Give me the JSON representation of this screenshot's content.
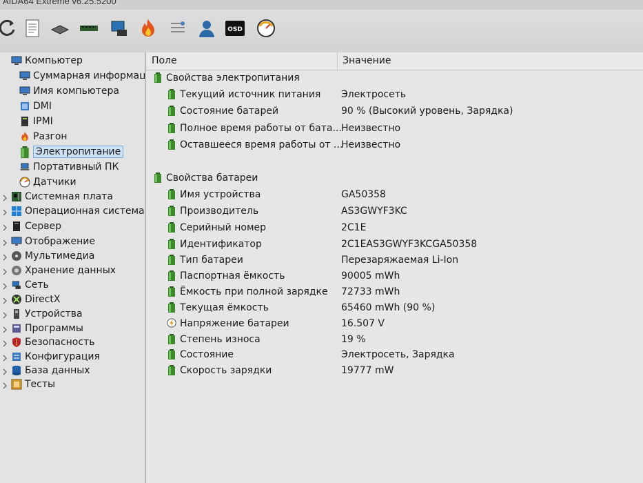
{
  "window": {
    "title": "AIDA64 Extreme v6.25.5200"
  },
  "toolbar": {
    "buttons": [
      {
        "name": "refresh-icon"
      },
      {
        "name": "report-icon"
      },
      {
        "name": "cpu-chip-icon"
      },
      {
        "name": "memory-icon"
      },
      {
        "name": "network-icon"
      },
      {
        "name": "flame-icon"
      },
      {
        "name": "checklist-icon"
      },
      {
        "name": "user-icon"
      },
      {
        "name": "osd-icon",
        "label": "OSD"
      },
      {
        "name": "gauge-icon"
      }
    ]
  },
  "tree": {
    "items": [
      {
        "label": "Компьютер",
        "icon": "computer-icon",
        "level": 0,
        "selected": false
      },
      {
        "label": "Суммарная информац",
        "icon": "computer-icon",
        "level": 1,
        "selected": false
      },
      {
        "label": "Имя компьютера",
        "icon": "computer-icon",
        "level": 1,
        "selected": false
      },
      {
        "label": "DMI",
        "icon": "dmi-icon",
        "level": 1,
        "selected": false
      },
      {
        "label": "IPMI",
        "icon": "ipmi-icon",
        "level": 1,
        "selected": false
      },
      {
        "label": "Разгон",
        "icon": "flame-icon",
        "level": 1,
        "selected": false
      },
      {
        "label": "Электропитание",
        "icon": "battery-icon",
        "level": 1,
        "selected": true
      },
      {
        "label": "Портативный ПК",
        "icon": "laptop-icon",
        "level": 1,
        "selected": false
      },
      {
        "label": "Датчики",
        "icon": "sensor-icon",
        "level": 1,
        "selected": false
      },
      {
        "label": "Системная плата",
        "icon": "motherboard-icon",
        "level": 0,
        "selected": false
      },
      {
        "label": "Операционная система",
        "icon": "windows-icon",
        "level": 0,
        "selected": false
      },
      {
        "label": "Сервер",
        "icon": "server-icon",
        "level": 0,
        "selected": false
      },
      {
        "label": "Отображение",
        "icon": "display-icon",
        "level": 0,
        "selected": false
      },
      {
        "label": "Мультимедиа",
        "icon": "multimedia-icon",
        "level": 0,
        "selected": false
      },
      {
        "label": "Хранение данных",
        "icon": "storage-icon",
        "level": 0,
        "selected": false
      },
      {
        "label": "Сеть",
        "icon": "network-icon",
        "level": 0,
        "selected": false
      },
      {
        "label": "DirectX",
        "icon": "directx-icon",
        "level": 0,
        "selected": false
      },
      {
        "label": "Устройства",
        "icon": "devices-icon",
        "level": 0,
        "selected": false
      },
      {
        "label": "Программы",
        "icon": "programs-icon",
        "level": 0,
        "selected": false
      },
      {
        "label": "Безопасность",
        "icon": "shield-icon",
        "level": 0,
        "selected": false
      },
      {
        "label": "Конфигурация",
        "icon": "config-icon",
        "level": 0,
        "selected": false
      },
      {
        "label": "База данных",
        "icon": "database-icon",
        "level": 0,
        "selected": false
      },
      {
        "label": "Тесты",
        "icon": "tests-icon",
        "level": 0,
        "selected": false
      }
    ]
  },
  "table": {
    "columns": {
      "field": "Поле",
      "value": "Значение"
    },
    "rows": [
      {
        "type": "group",
        "field": "Свойства электропитания",
        "icon": "battery-icon"
      },
      {
        "type": "item",
        "field": "Текущий источник питания",
        "value": "Электросеть",
        "icon": "battery-icon"
      },
      {
        "type": "item",
        "field": "Состояние батарей",
        "value": "90 % (Высокий уровень, Зарядка)",
        "icon": "battery-icon"
      },
      {
        "type": "item",
        "field": "Полное время работы от бата...",
        "value": "Неизвестно",
        "icon": "battery-icon"
      },
      {
        "type": "item",
        "field": "Оставшееся время работы от ...",
        "value": "Неизвестно",
        "icon": "battery-icon"
      },
      {
        "type": "group",
        "field": "Свойства батареи",
        "icon": "battery-icon"
      },
      {
        "type": "item",
        "field": "Имя устройства",
        "value": "GA50358",
        "icon": "battery-icon"
      },
      {
        "type": "item",
        "field": "Производитель",
        "value": "AS3GWYF3KC",
        "icon": "battery-icon"
      },
      {
        "type": "item",
        "field": "Серийный номер",
        "value": "2C1E",
        "icon": "battery-icon"
      },
      {
        "type": "item",
        "field": "Идентификатор",
        "value": "2C1EAS3GWYF3KCGA50358",
        "icon": "battery-icon"
      },
      {
        "type": "item",
        "field": "Тип батареи",
        "value": "Перезаряжаемая Li-Ion",
        "icon": "battery-icon"
      },
      {
        "type": "item",
        "field": "Паспортная ёмкость",
        "value": "90005 mWh",
        "icon": "battery-icon"
      },
      {
        "type": "item",
        "field": "Ёмкость при полной зарядке",
        "value": "72733 mWh",
        "icon": "battery-icon"
      },
      {
        "type": "item",
        "field": "Текущая ёмкость",
        "value": "65460 mWh  (90 %)",
        "icon": "battery-icon"
      },
      {
        "type": "item",
        "field": "Напряжение батареи",
        "value": "16.507 V",
        "icon": "voltage-icon"
      },
      {
        "type": "item",
        "field": "Степень износа",
        "value": "19 %",
        "icon": "battery-icon"
      },
      {
        "type": "item",
        "field": "Состояние",
        "value": "Электросеть, Зарядка",
        "icon": "battery-icon"
      },
      {
        "type": "item",
        "field": "Скорость зарядки",
        "value": "19777 mW",
        "icon": "battery-icon"
      }
    ]
  },
  "colors": {
    "battery": "#3f8a2e",
    "selection": "#cde1f5",
    "selection_border": "#7aa5d6"
  }
}
